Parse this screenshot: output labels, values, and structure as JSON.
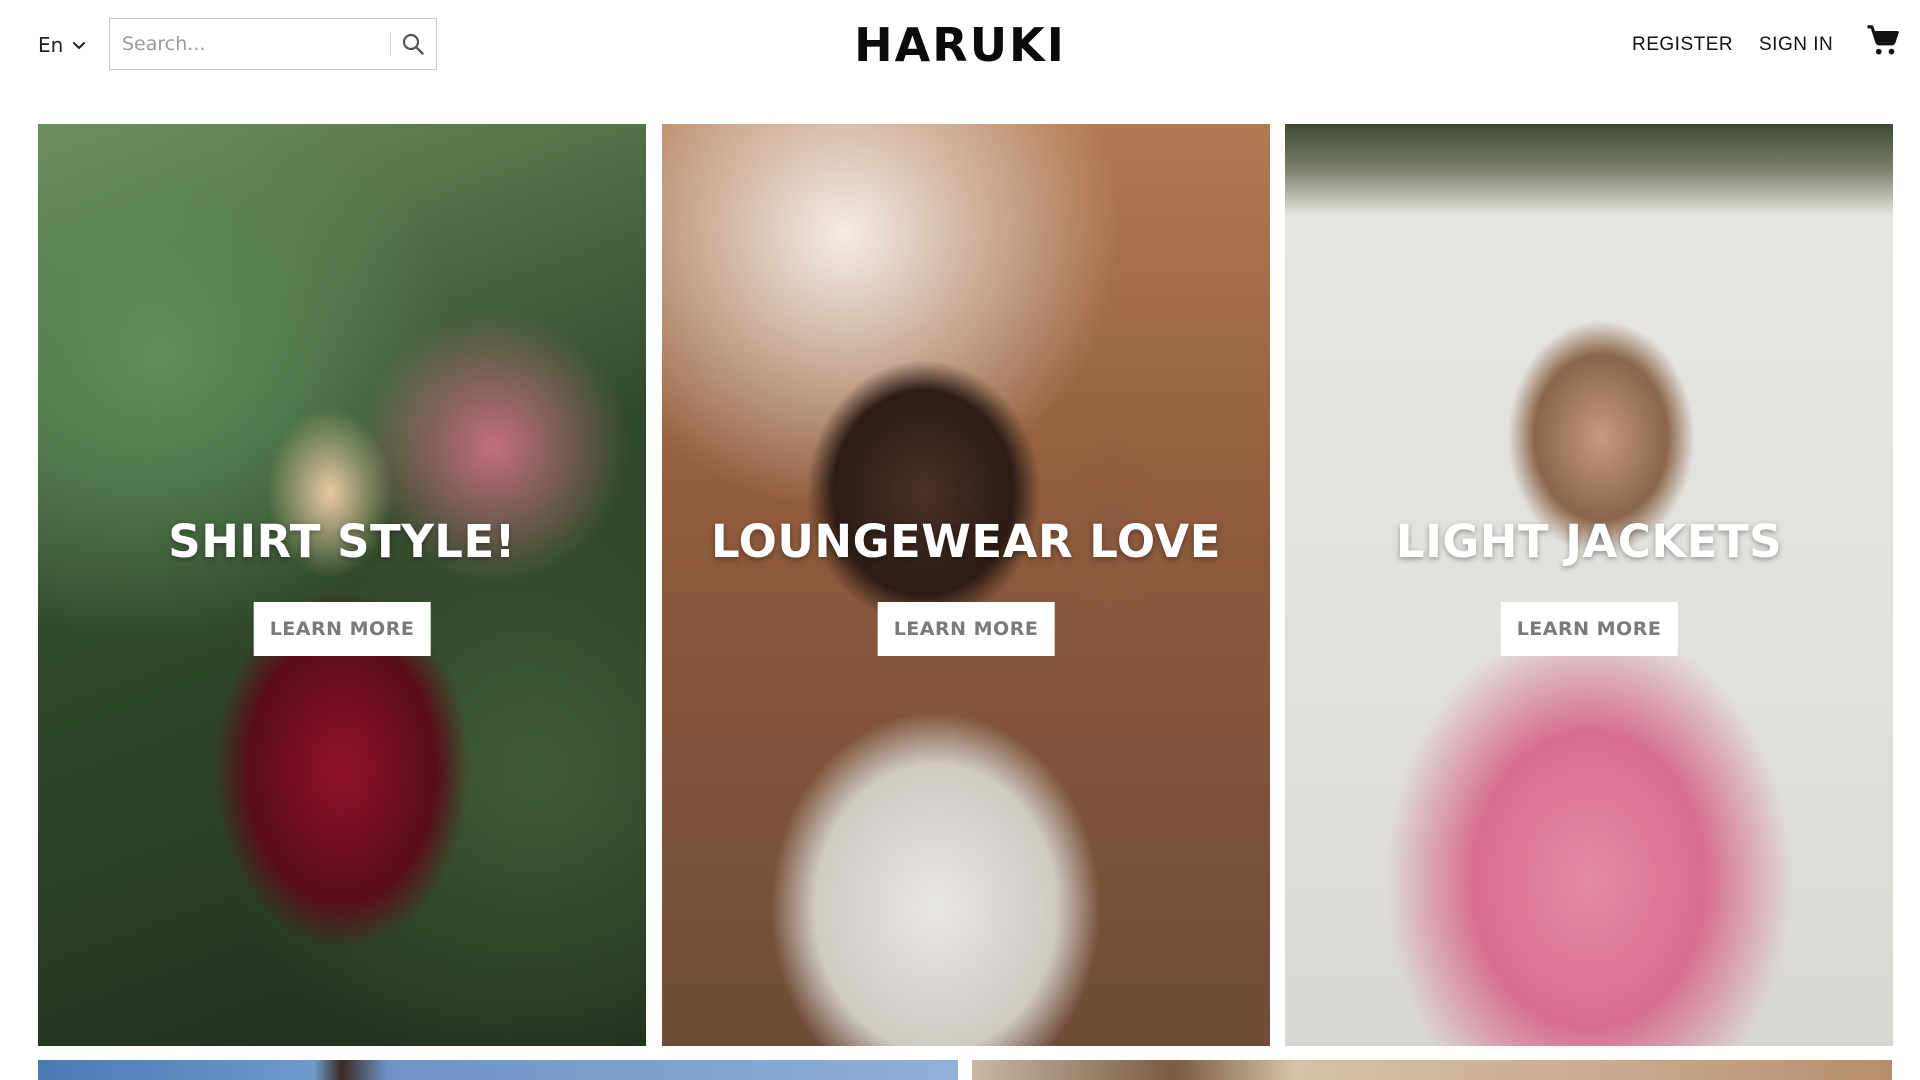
{
  "header": {
    "language": "En",
    "search_placeholder": "Search...",
    "logo": "HARUKI",
    "register": "REGISTER",
    "sign_in": "SIGN IN"
  },
  "icons": {
    "language_dropdown": "chevron-down-icon",
    "search": "search-icon",
    "cart": "cart-icon"
  },
  "tiles": [
    {
      "title": "SHIRT STYLE!",
      "button": "LEARN MORE"
    },
    {
      "title": "LOUNGEWEAR LOVE",
      "button": "LEARN MORE"
    },
    {
      "title": "LIGHT JACKETS",
      "button": "LEARN MORE"
    }
  ],
  "colors": {
    "background": "#ffffff",
    "text": "#111111",
    "button_bg": "#ffffff",
    "button_text": "#7a7a7a",
    "tile_title": "#ffffff"
  }
}
